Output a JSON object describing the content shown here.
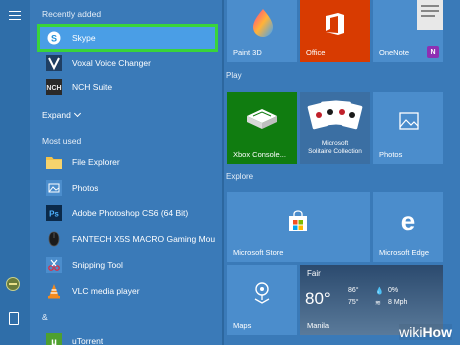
{
  "sections": {
    "recently_added": "Recently added",
    "expand": "Expand",
    "most_used": "Most used",
    "letter_a": "&",
    "play": "Play",
    "explore": "Explore"
  },
  "recent_apps": [
    {
      "label": "Skype",
      "icon": "skype-icon",
      "selected": true
    },
    {
      "label": "Voxal Voice Changer",
      "icon": "voxal-icon"
    },
    {
      "label": "NCH Suite",
      "icon": "nch-icon"
    }
  ],
  "most_used_apps": [
    {
      "label": "File Explorer",
      "icon": "folder-icon"
    },
    {
      "label": "Photos",
      "icon": "photos-icon"
    },
    {
      "label": "Adobe Photoshop CS6 (64 Bit)",
      "icon": "photoshop-icon"
    },
    {
      "label": "FANTECH X5S MACRO Gaming Mou...",
      "icon": "mouse-icon"
    },
    {
      "label": "Snipping Tool",
      "icon": "scissors-icon"
    },
    {
      "label": "VLC media player",
      "icon": "vlc-icon"
    }
  ],
  "a_apps": [
    {
      "label": "uTorrent",
      "icon": "utorrent-icon"
    }
  ],
  "tiles": {
    "paint3d": "Paint 3D",
    "office": "Office",
    "onenote": "OneNote",
    "xbox": "Xbox Console...",
    "solitaire_line1": "Microsoft",
    "solitaire_line2": "Solitaire Collection",
    "photos": "Photos",
    "store": "Microsoft Store",
    "edge": "Microsoft Edge",
    "maps": "Maps"
  },
  "weather": {
    "condition": "Fair",
    "temp": "80°",
    "high": "86°",
    "low": "75°",
    "precip": "0%",
    "wind": "8 Mph",
    "city": "Manila"
  },
  "watermark": {
    "part1": "wiki",
    "part2": "How"
  },
  "colors": {
    "background": "#3a7ab8",
    "selected_row": "#4a9ee6",
    "highlight_border": "#39d43a",
    "office_tile": "#d83b01",
    "xbox_tile": "#107c10",
    "tile_blue": "#4b8dcc"
  }
}
